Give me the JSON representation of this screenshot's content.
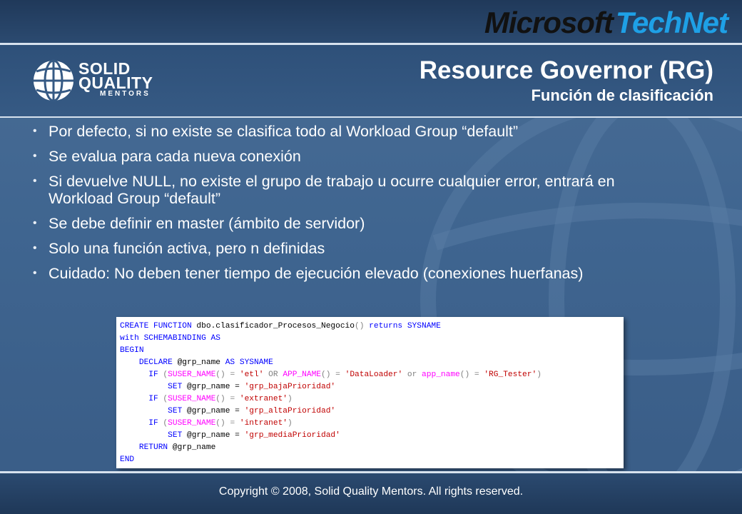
{
  "brand": {
    "microsoft": "Microsoft",
    "technet": "TechNet",
    "sqm_line1": "SOLID",
    "sqm_line2": "QUALITY",
    "sqm_line3": "MENTORS"
  },
  "header": {
    "title": "Resource Governor (RG)",
    "subtitle": "Función de clasificación"
  },
  "bullets": [
    "Por defecto, si no existe se clasifica todo al Workload Group “default”",
    "Se evalua para cada nueva conexión",
    "Si devuelve NULL, no existe el grupo de trabajo u ocurre cualquier error, entrará en Workload Group “default”",
    "Se debe definir en master (ámbito de servidor)",
    "Solo una función activa, pero n definidas",
    "Cuidado: No deben tener tiempo de ejecución elevado (conexiones huerfanas)"
  ],
  "code": {
    "l1_kw": "CREATE FUNCTION",
    "l1_name": " dbo.clasificador_Procesos_Negocio",
    "l1_paren": "()",
    "l1_returns": " returns SYSNAME",
    "l2": "with SCHEMABINDING AS",
    "l3": "BEGIN",
    "l4_declare": "    DECLARE",
    "l4_var": " @grp_name ",
    "l4_as": "AS SYSNAME",
    "l5_if": "      IF",
    "l5_open": " (",
    "l5_fn1": "SUSER_NAME",
    "l5_eq1": "() = ",
    "l5_s1": "'etl'",
    "l5_or": " OR ",
    "l5_fn2": "APP_NAME",
    "l5_eq2": "() = ",
    "l5_s2": "'DataLoader'",
    "l5_or2": " or ",
    "l5_fn3": "app_name",
    "l5_eq3": "() = ",
    "l5_s3": "'RG_Tester'",
    "l5_close": ")",
    "set_kw": "          SET",
    "set_var": " @grp_name = ",
    "s_baja": "'grp_bajaPrioridad'",
    "s_extranet": "'extranet'",
    "s_alta": "'grp_altaPrioridad'",
    "s_intranet": "'intranet'",
    "s_media": "'grp_mediaPrioridad'",
    "if_kw": "      IF",
    "open": " (",
    "suser": "SUSER_NAME",
    "eq": "() = ",
    "close": ")",
    "return_kw": "    RETURN",
    "return_var": " @grp_name",
    "end": "END"
  },
  "footer": {
    "copyright": "Copyright © 2008, Solid Quality Mentors. All rights reserved."
  }
}
